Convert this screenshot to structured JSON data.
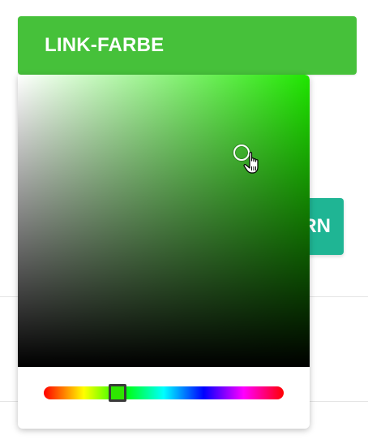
{
  "header": {
    "title": "LINK-FARBE"
  },
  "background_button": {
    "visible_label": "RN"
  },
  "color_picker": {
    "selected_hue_color": "#2ee600",
    "gradient_hue_color": "#1fe600"
  },
  "colors": {
    "header_bg": "#46c13a",
    "teal_button_bg": "#1fb594"
  },
  "icons": {
    "cursor": "hand-pointer-icon"
  }
}
